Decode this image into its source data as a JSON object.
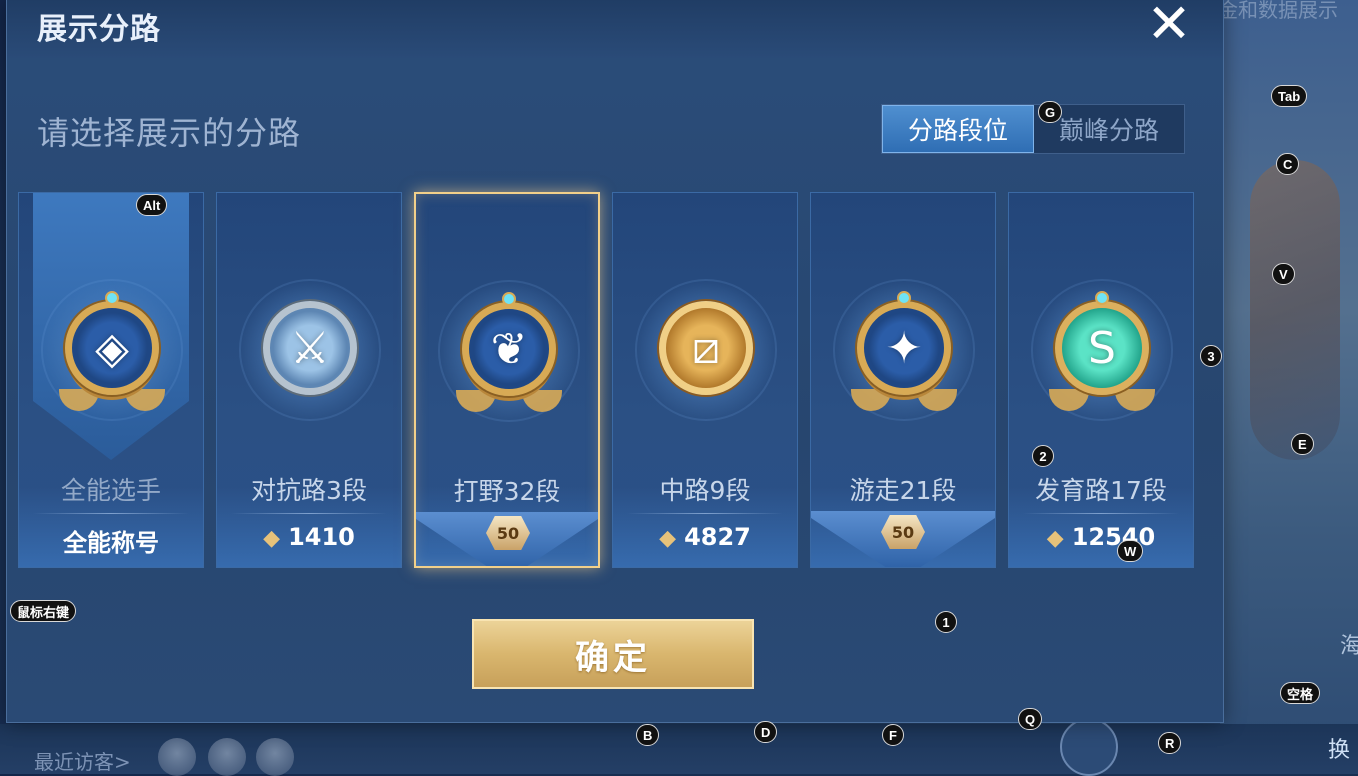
{
  "background": {
    "top_text": "金和数据展示",
    "recent_visitors_label": "最近访客>",
    "right_char_a": "换",
    "right_char_b": "海"
  },
  "dialog": {
    "title": "展示分路",
    "subtitle": "请选择展示的分路",
    "close_glyph": "✕",
    "tabs": [
      {
        "label": "分路段位",
        "active": true
      },
      {
        "label": "巅峰分路",
        "active": false
      }
    ],
    "confirm_label": "确定"
  },
  "cards": [
    {
      "name": "全能选手",
      "value": "全能称号",
      "emblem": "all-round-emblem-icon",
      "glyph": "◈",
      "value_type": "text"
    },
    {
      "name": "对抗路3段",
      "value": "1410",
      "emblem": "clash-lane-emblem-icon",
      "glyph": "⚔",
      "value_type": "points"
    },
    {
      "name": "打野32段",
      "value": "50",
      "emblem": "jungle-emblem-icon",
      "glyph": "❦",
      "value_type": "badge",
      "selected": true
    },
    {
      "name": "中路9段",
      "value": "4827",
      "emblem": "mid-lane-emblem-icon",
      "glyph": "⧄",
      "value_type": "points"
    },
    {
      "name": "游走21段",
      "value": "50",
      "emblem": "roam-emblem-icon",
      "glyph": "✦",
      "value_type": "badge"
    },
    {
      "name": "发育路17段",
      "value": "12540",
      "emblem": "farm-lane-emblem-icon",
      "glyph": "S",
      "value_type": "points"
    }
  ],
  "hints": {
    "alt": "Alt",
    "g": "G",
    "tab": "Tab",
    "c": "C",
    "v": "V",
    "three": "3",
    "e": "E",
    "two": "2",
    "w": "W",
    "right_click": "鼠标右键",
    "one": "1",
    "space": "空格",
    "q": "Q",
    "b": "B",
    "d": "D",
    "f": "F",
    "r": "R"
  },
  "colors": {
    "accent_gold": "#d8aa55",
    "tab_active": "#2f6eb4",
    "dialog_bg": "#27466f"
  }
}
